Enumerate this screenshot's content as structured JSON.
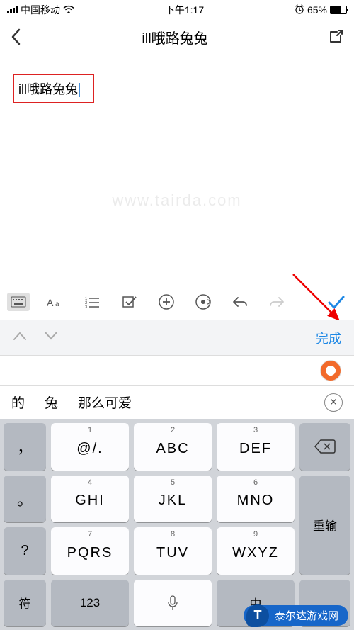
{
  "status": {
    "carrier": "中国移动",
    "time": "下午1:17",
    "battery_pct": "65%"
  },
  "navbar": {
    "title": "ill哦路兔兔"
  },
  "input_text": "ill哦路兔兔",
  "cand_top": {
    "done": "完成"
  },
  "candidates": {
    "w1": "的",
    "w2": "兔",
    "w3": "那么可爱"
  },
  "keyboard": {
    "k1_num": "1",
    "k1": "@/.",
    "k2_num": "2",
    "k2": "ABC",
    "k3_num": "3",
    "k3": "DEF",
    "k4_num": "4",
    "k4": "GHI",
    "k5_num": "5",
    "k5": "JKL",
    "k6_num": "6",
    "k6": "MNO",
    "k7_num": "7",
    "k7": "PQRS",
    "k8_num": "8",
    "k8": "TUV",
    "k9_num": "9",
    "k9": "WXYZ",
    "comma": "，",
    "period": "。",
    "symbol": "符",
    "switch": "123",
    "lang": "中",
    "reinput": "重输"
  },
  "watermark": "www.tairda.com",
  "brand": "泰尔达游戏网"
}
